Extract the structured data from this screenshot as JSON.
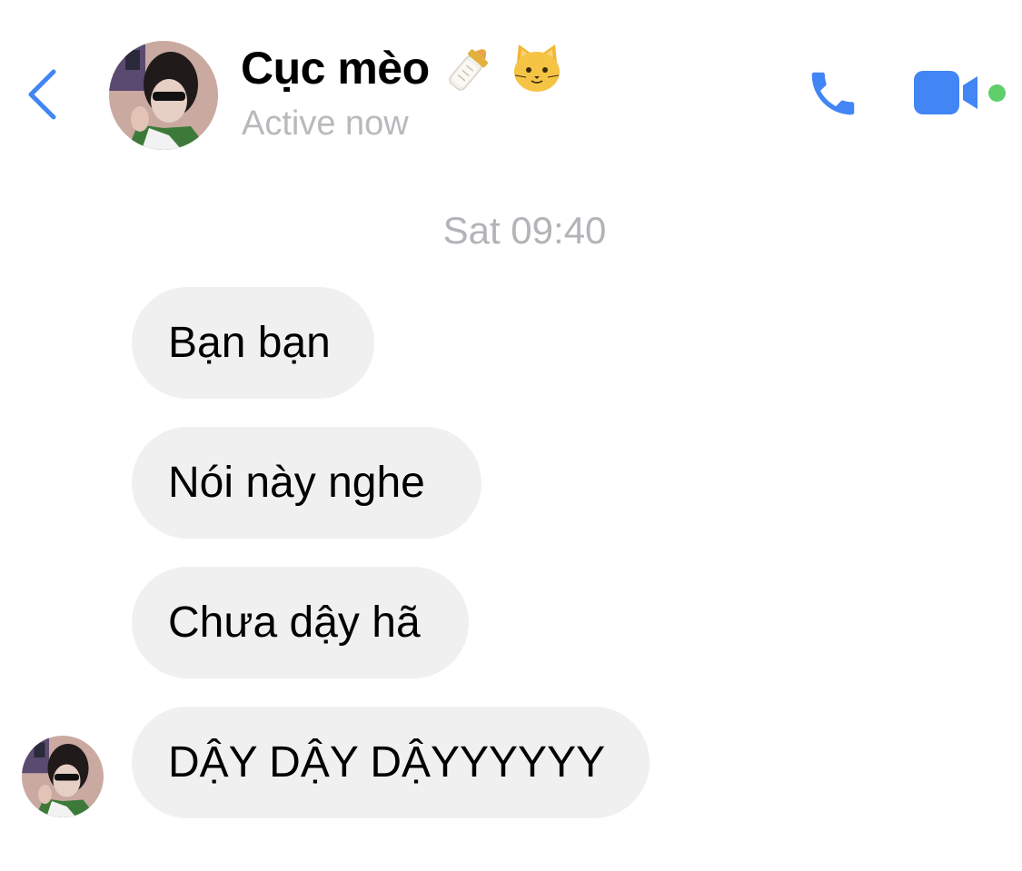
{
  "header": {
    "back_icon": "chevron-left-icon",
    "contact_name": "Cục mèo",
    "name_emojis": [
      "baby-bottle-emoji",
      "cat-face-emoji"
    ],
    "status": "Active now",
    "call_icon": "phone-icon",
    "video_icon": "video-camera-icon",
    "presence": "online"
  },
  "conversation": {
    "timestamp": "Sat 09:40",
    "messages": [
      {
        "text": "Bạn bạn",
        "direction": "incoming"
      },
      {
        "text": "Nói này nghe",
        "direction": "incoming"
      },
      {
        "text": "Chưa dậy hã",
        "direction": "incoming"
      },
      {
        "text": "DẬY DẬY DẬYYYYYY",
        "direction": "incoming"
      }
    ]
  },
  "colors": {
    "accent": "#4285f4",
    "bubble_background": "#f0f0f0",
    "secondary_text": "#b3b3b8",
    "presence_online": "#5fcf6b"
  }
}
